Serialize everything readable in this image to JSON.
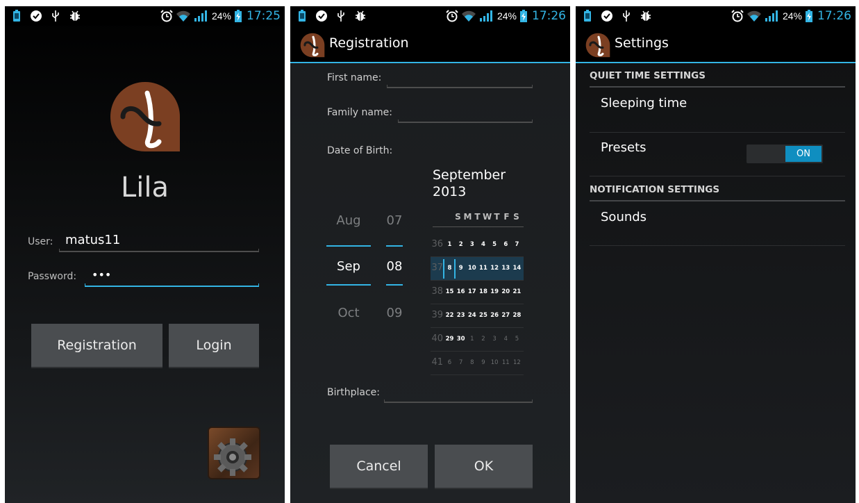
{
  "status_bars": [
    {
      "battery_pct": "24%",
      "time": "17:25"
    },
    {
      "battery_pct": "24%",
      "time": "17:26"
    },
    {
      "battery_pct": "24%",
      "time": "17:26"
    }
  ],
  "colors": {
    "accent": "#33b5e5",
    "logo_brown": "#7b3f22",
    "toggle_on": "#0f8ec0"
  },
  "login": {
    "app_name": "Lila",
    "user_label": "User:",
    "user_value": "matus11",
    "password_label": "Password:",
    "password_value": "•••",
    "registration_button": "Registration",
    "login_button": "Login",
    "settings_icon": "gear-icon"
  },
  "registration": {
    "title": "Registration",
    "first_name_label": "First name:",
    "family_name_label": "Family name:",
    "dob_label": "Date of Birth:",
    "birthplace_label": "Birthplace:",
    "picker": {
      "months": [
        "Aug",
        "Sep",
        "Oct"
      ],
      "days": [
        "07",
        "08",
        "09"
      ]
    },
    "calendar": {
      "month_title_line1": "September",
      "month_title_line2": "2013",
      "weekday_header": [
        "S",
        "M",
        "T",
        "W",
        "T",
        "F",
        "S"
      ],
      "weeks": [
        {
          "week": "36",
          "days": [
            "1",
            "2",
            "3",
            "4",
            "5",
            "6",
            "7"
          ]
        },
        {
          "week": "37",
          "days": [
            "8",
            "9",
            "10",
            "11",
            "12",
            "13",
            "14"
          ]
        },
        {
          "week": "38",
          "days": [
            "15",
            "16",
            "17",
            "18",
            "19",
            "20",
            "21"
          ]
        },
        {
          "week": "39",
          "days": [
            "22",
            "23",
            "24",
            "25",
            "26",
            "27",
            "28"
          ]
        },
        {
          "week": "40",
          "days": [
            "29",
            "30",
            "1",
            "2",
            "3",
            "4",
            "5"
          ]
        },
        {
          "week": "41",
          "days": [
            "6",
            "7",
            "8",
            "9",
            "10",
            "11",
            "12"
          ]
        }
      ]
    },
    "cancel_button": "Cancel",
    "ok_button": "OK"
  },
  "settings": {
    "title": "Settings",
    "quiet_category": "QUIET TIME SETTINGS",
    "sleeping_time": "Sleeping time",
    "presets": "Presets",
    "presets_toggle": "ON",
    "notification_category": "NOTIFICATION SETTINGS",
    "sounds": "Sounds"
  }
}
